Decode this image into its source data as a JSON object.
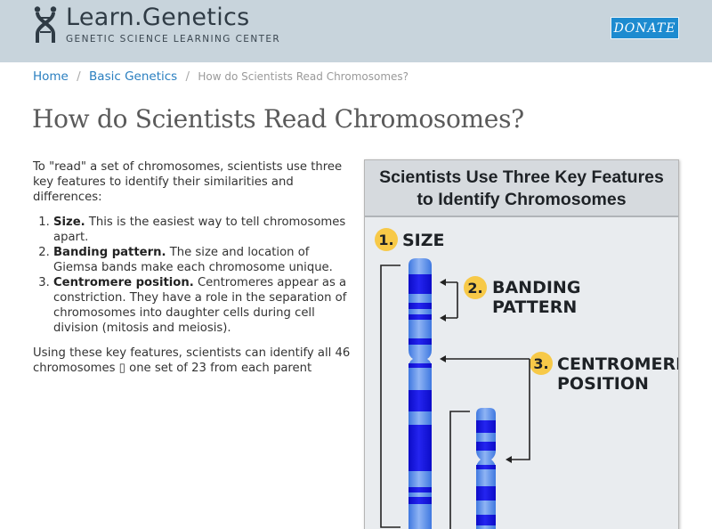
{
  "header": {
    "logo_title": "Learn.Genetics",
    "logo_subtitle": "GENETIC SCIENCE LEARNING CENTER",
    "donate_label": "DONATE",
    "background_color": "#c8d4dc",
    "donate_color": "#1d8bd0"
  },
  "breadcrumb": {
    "items": [
      "Home",
      "Basic Genetics"
    ],
    "separator": "/",
    "current": "How do Scientists Read Chromosomes?"
  },
  "page": {
    "title": "How do Scientists Read Chromosomes?",
    "intro": "To \"read\" a set of chromosomes, scientists use three key features to identify their similarities and differences:",
    "list": [
      {
        "term": "Size.",
        "text": " This is the easiest way to tell chromosomes apart."
      },
      {
        "term": "Banding pattern.",
        "text": " The size and location of Giemsa bands make each chromosome unique."
      },
      {
        "term": "Centromere position.",
        "text": " Centromeres appear as a constriction. They have a role in the separation of chromosomes into daughter cells during cell division (mitosis and meiosis)."
      }
    ],
    "outro": "Using these key features, scientists can identify all 46 chromosomes ▯ one set of 23 from each parent"
  },
  "figure": {
    "title_line1": "Scientists Use Three Key Features",
    "title_line2": "to Identify Chromosomes",
    "labels": [
      {
        "num": "1.",
        "lines": [
          "SIZE"
        ]
      },
      {
        "num": "2.",
        "lines": [
          "BANDING",
          "PATTERN"
        ]
      },
      {
        "num": "3.",
        "lines": [
          "CENTROMERE",
          "POSITION"
        ]
      }
    ],
    "badge_color": "#f7c948",
    "chromosome_color": "#5b8fe8",
    "band_color": "#1414e0"
  }
}
